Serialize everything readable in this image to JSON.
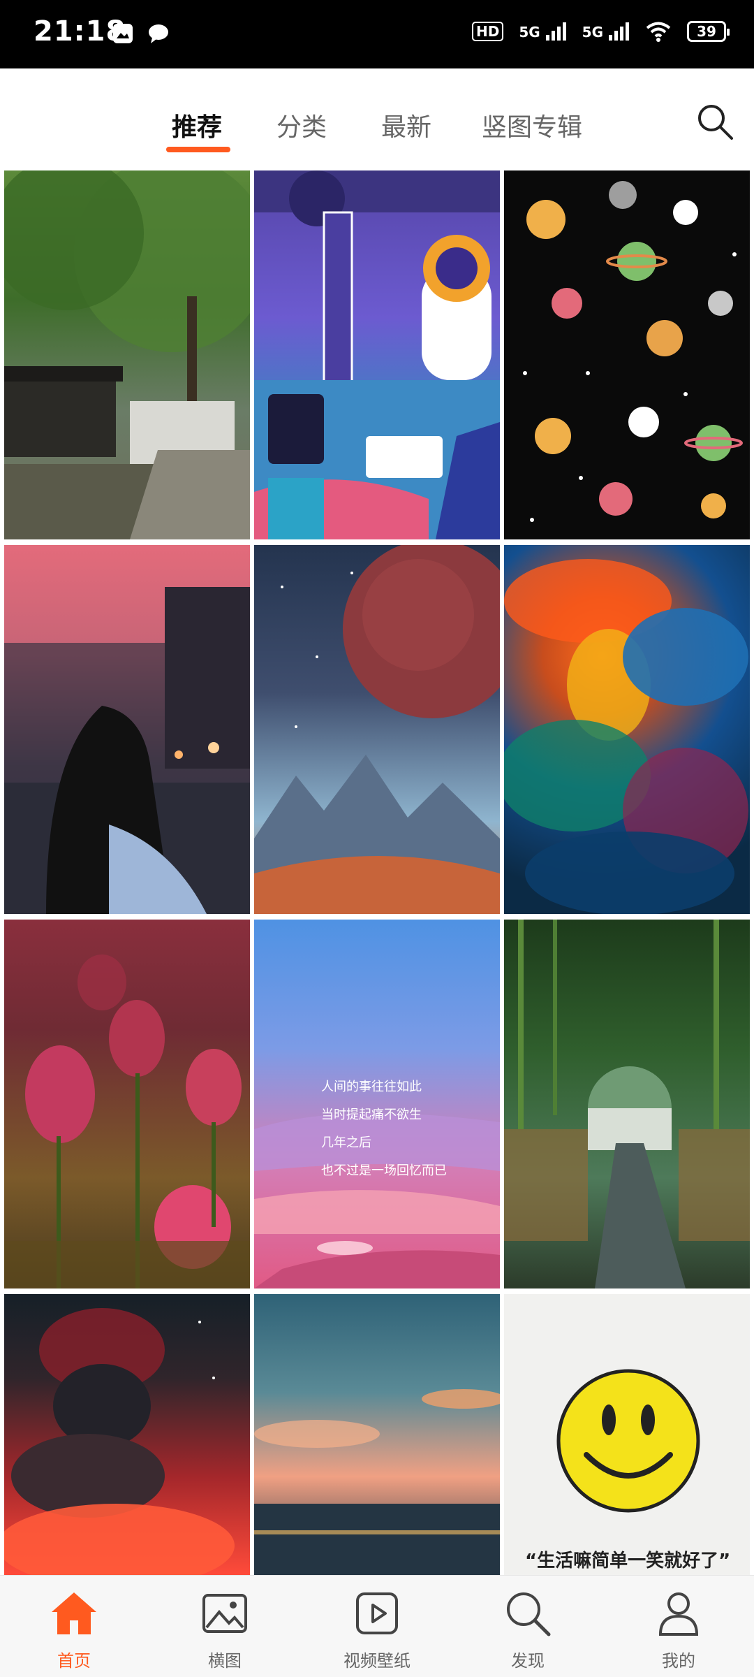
{
  "status": {
    "time": "21:18",
    "net1": "5G",
    "net2": "5G",
    "battery": "39",
    "hd": "HD"
  },
  "top_tabs": [
    {
      "label": "推荐",
      "active": true
    },
    {
      "label": "分类",
      "active": false
    },
    {
      "label": "最新",
      "active": false
    },
    {
      "label": "竖图专辑",
      "active": false
    }
  ],
  "grid": {
    "poem_lines": [
      "人间的事往往如此",
      "当时提起痛不欲生",
      "几年之后",
      "也不过是一场回忆而已"
    ],
    "smile_caption": "“生活嘛简单一笑就好了”"
  },
  "bottom_nav": [
    {
      "label": "首页",
      "icon": "home-icon",
      "active": true
    },
    {
      "label": "横图",
      "icon": "image-icon",
      "active": false
    },
    {
      "label": "视频壁纸",
      "icon": "video-icon",
      "active": false
    },
    {
      "label": "发现",
      "icon": "discover-search-icon",
      "active": false
    },
    {
      "label": "我的",
      "icon": "profile-icon",
      "active": false
    }
  ],
  "colors": {
    "accent": "#ff5a1f",
    "nav_bg": "#f7f7f7"
  }
}
